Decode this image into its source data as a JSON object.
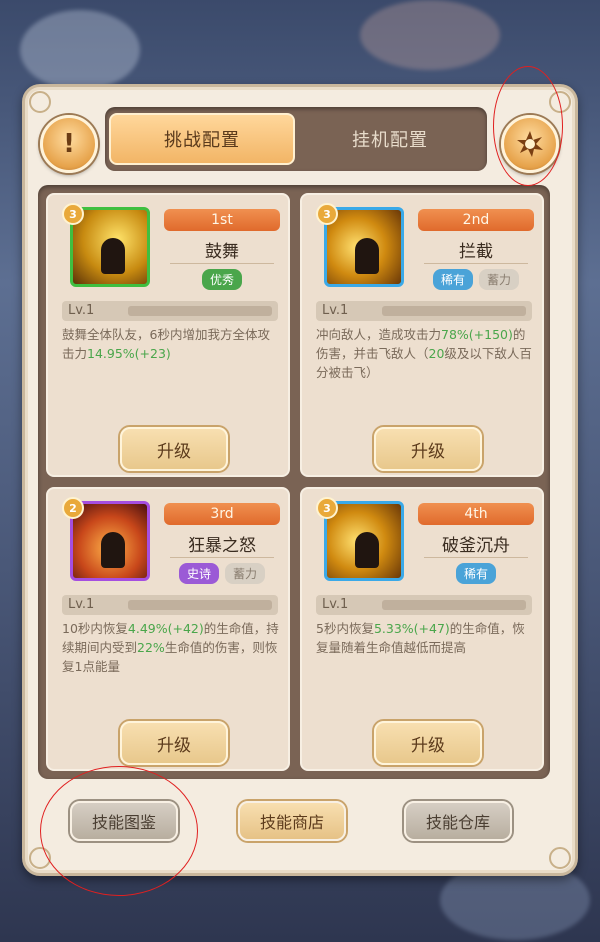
{
  "tabs": [
    {
      "label": "挑战配置",
      "active": true
    },
    {
      "label": "挂机配置",
      "active": false
    }
  ],
  "icons": {
    "info": "exclamation-icon",
    "auto": "burst-settings-icon"
  },
  "cards": [
    {
      "level_badge": "3",
      "rank": "1st",
      "name": "鼓舞",
      "tags": [
        {
          "text": "优秀",
          "color": "green"
        }
      ],
      "frame": "green",
      "level": "Lv.1",
      "desc_parts": [
        "鼓舞全体队友，6秒内增加我方全体攻击力",
        "14.95%(+23)",
        ""
      ],
      "upgrade_label": "升级"
    },
    {
      "level_badge": "3",
      "rank": "2nd",
      "name": "拦截",
      "tags": [
        {
          "text": "稀有",
          "color": "blue"
        },
        {
          "text": "蓄力",
          "color": "gray"
        }
      ],
      "frame": "blue",
      "level": "Lv.1",
      "desc_parts": [
        "冲向敌人，造成攻击力",
        "78%(+150)",
        "的伤害，并击飞敌人（",
        "20",
        "级及以下敌人百分被击飞）"
      ],
      "upgrade_label": "升级"
    },
    {
      "level_badge": "2",
      "rank": "3rd",
      "name": "狂暴之怒",
      "tags": [
        {
          "text": "史诗",
          "color": "purple"
        },
        {
          "text": "蓄力",
          "color": "gray"
        }
      ],
      "frame": "purple",
      "level": "Lv.1",
      "desc_parts": [
        "10秒内恢复",
        "4.49%(+42)",
        "的生命值，持续期间内受到",
        "22%",
        "生命值的伤害，则恢复1点能量"
      ],
      "upgrade_label": "升级"
    },
    {
      "level_badge": "3",
      "rank": "4th",
      "name": "破釜沉舟",
      "tags": [
        {
          "text": "稀有",
          "color": "blue"
        }
      ],
      "frame": "blue",
      "level": "Lv.1",
      "desc_parts": [
        "5秒内恢复",
        "5.33%(+47)",
        "的生命值，恢复量随着生命值越低而提高"
      ],
      "upgrade_label": "升级"
    }
  ],
  "bottom_buttons": [
    {
      "label": "技能图鉴",
      "style": "gray"
    },
    {
      "label": "技能商店",
      "style": "gold"
    },
    {
      "label": "技能仓库",
      "style": "gray"
    }
  ]
}
